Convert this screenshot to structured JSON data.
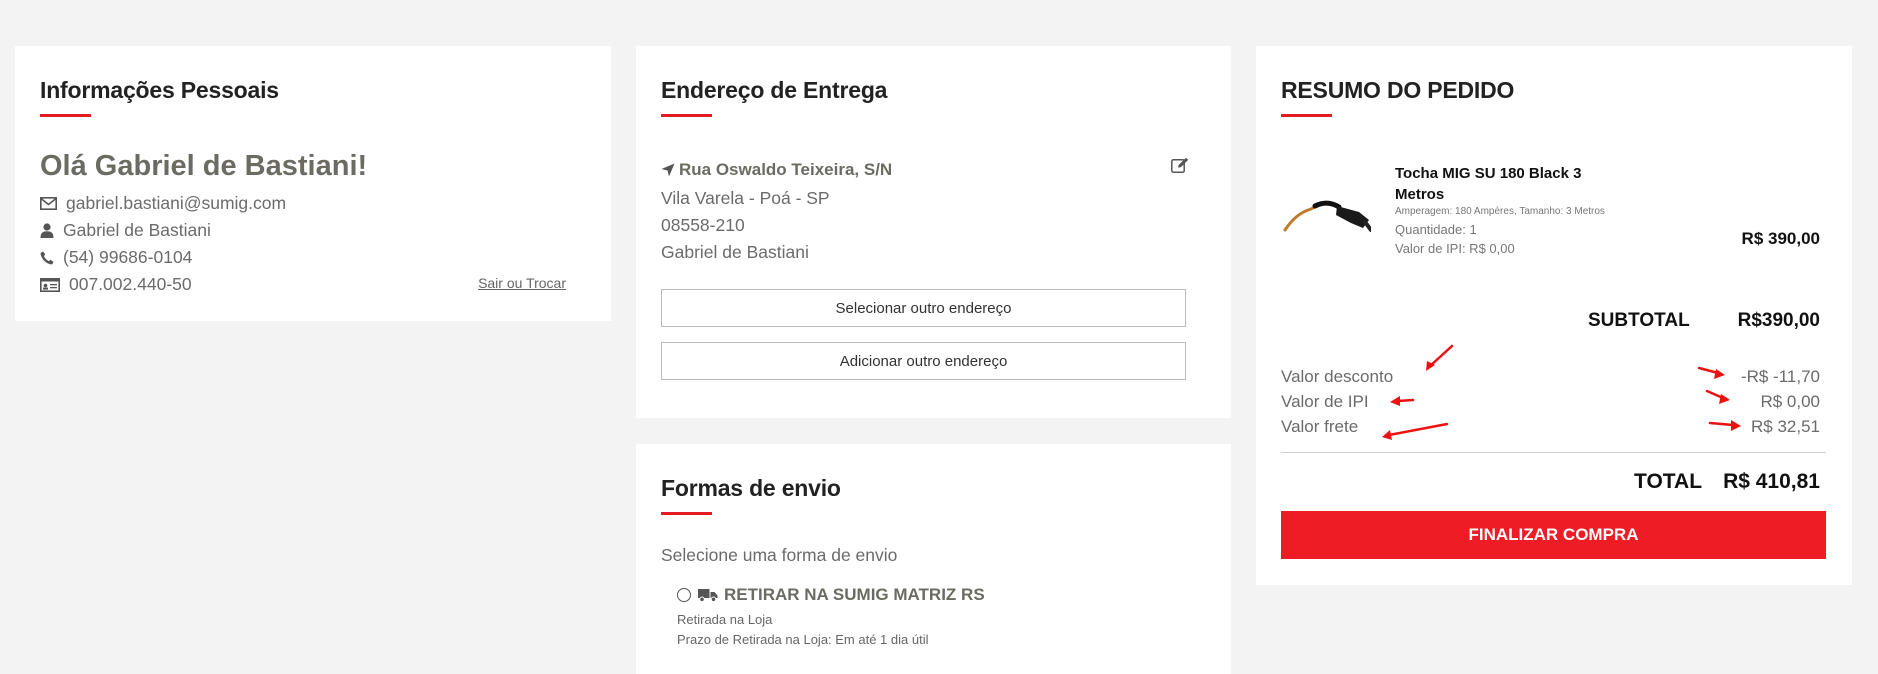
{
  "personal": {
    "title": "Informações Pessoais",
    "greeting": "Olá Gabriel de Bastiani!",
    "email": "gabriel.bastiani@sumig.com",
    "name": "Gabriel de Bastiani",
    "phone": "(54) 99686-0104",
    "document": "007.002.440-50",
    "logout_link": "Sair ou Trocar"
  },
  "address": {
    "title": "Endereço de Entrega",
    "street": "Rua Oswaldo Teixeira, S/N",
    "district": "Vila Varela - Poá - SP",
    "zip": "08558-210",
    "recipient": "Gabriel de Bastiani",
    "select_button": "Selecionar outro endereço",
    "add_button": "Adicionar outro endereço"
  },
  "shipping": {
    "title": "Formas de envio",
    "prompt": "Selecione uma forma de envio",
    "option_label": "RETIRAR NA SUMIG MATRIZ RS",
    "option_sub1": "Retirada na Loja",
    "option_sub2": "Prazo de Retirada na Loja: Em até 1 dia útil",
    "selected": false
  },
  "summary": {
    "title": "RESUMO DO PEDIDO",
    "product": {
      "name": "Tocha MIG SU 180 Black 3 Metros",
      "specs": "Amperagem: 180 Ampères, Tamanho: 3 Metros",
      "quantity": "Quantidade: 1",
      "ipi": "Valor de IPI: R$ 0,00",
      "price": "R$ 390,00"
    },
    "subtotal_label": "SUBTOTAL",
    "subtotal_value": "R$390,00",
    "discount_label": "Valor desconto",
    "discount_value": "-R$ -11,70",
    "ipi_label": "Valor de IPI",
    "ipi_value": "R$ 0,00",
    "freight_label": "Valor frete",
    "freight_value": "R$ 32,51",
    "total_label": "TOTAL",
    "total_value": "R$ 410,81",
    "checkout_button": "FINALIZAR COMPRA"
  },
  "colors": {
    "accent": "#e31b23",
    "button": "#ee1c25",
    "background": "#f3f3f3",
    "annotation": "#ee1111"
  },
  "icons": [
    "envelope-icon",
    "user-icon",
    "phone-icon",
    "id-card-icon",
    "location-arrow-icon",
    "edit-icon",
    "truck-icon"
  ]
}
